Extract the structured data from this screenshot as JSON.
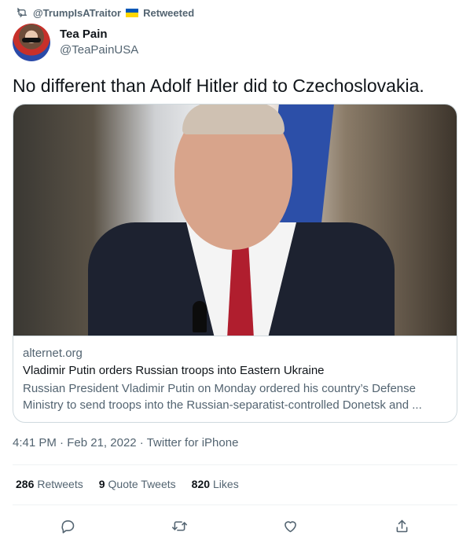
{
  "retweet": {
    "icon": "retweet-icon",
    "user": "@TrumpIsATraitor",
    "flag_colors": [
      "#0057b7",
      "#ffd700"
    ],
    "label": "Retweeted"
  },
  "author": {
    "display_name": "Tea Pain",
    "handle": "@TeaPainUSA"
  },
  "tweet": {
    "text": "No different than Adolf Hitler did to Czechoslovakia."
  },
  "card": {
    "domain": "alternet.org",
    "title": "Vladimir Putin orders Russian troops into Eastern Ukraine",
    "description": "Russian President Vladimir Putin on Monday ordered his country’s Defense Ministry to send troops into the Russian-separatist-controlled Donetsk and ..."
  },
  "meta": {
    "time": "4:41 PM",
    "separator": "·",
    "date": "Feb 21, 2022",
    "source": "Twitter for iPhone"
  },
  "stats": {
    "retweets_count": "286",
    "retweets_label": "Retweets",
    "quotes_count": "9",
    "quotes_label": "Quote Tweets",
    "likes_count": "820",
    "likes_label": "Likes"
  },
  "actions": [
    "reply-icon",
    "retweet-icon",
    "like-icon",
    "share-icon"
  ],
  "colors": {
    "text": "#0f1419",
    "secondary": "#536471",
    "border": "#cfd9de"
  }
}
